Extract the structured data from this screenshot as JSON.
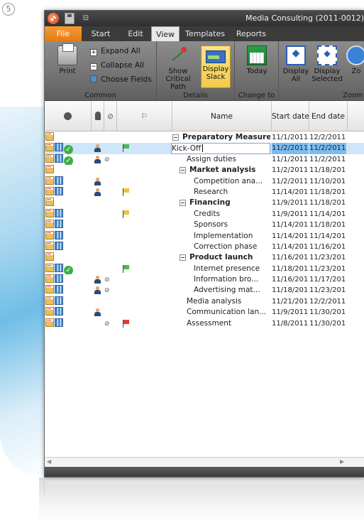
{
  "step_number": "5",
  "window": {
    "title": "Media Consulting (2011-0012)"
  },
  "ribbon_tabs": [
    "File",
    "Start",
    "Edit",
    "View",
    "Templates",
    "Reports"
  ],
  "active_tab": "View",
  "ribbon": {
    "common": {
      "label": "Common",
      "print": "Print",
      "expand_all": "Expand All",
      "collapse_all": "Collapse All",
      "choose_fields": "Choose Fields"
    },
    "details": {
      "label": "Details",
      "show_critical_path": "Show Critical Path",
      "display_slack": "Display Slack"
    },
    "change_to": {
      "label": "Change to",
      "today": "Today"
    },
    "zoom": {
      "label": "Zoom",
      "display_all": "Display All",
      "display_selected": "Display Selected",
      "zoom_partial": "Zo"
    }
  },
  "grid": {
    "columns": {
      "name": "Name",
      "start_date": "Start date",
      "end_date": "End date"
    },
    "rows": [
      {
        "icons": [
          "note"
        ],
        "user": false,
        "attach": false,
        "flag": "",
        "indent": 0,
        "toggle": "−",
        "name": "Preparatory Measures",
        "bold": true,
        "start": "11/1/2011...",
        "end": "12/2/2011..."
      },
      {
        "icons": [
          "note",
          "grid2",
          "check"
        ],
        "user": true,
        "attach": false,
        "flag": "green",
        "indent": 0,
        "toggle": "",
        "name": "Kick-Off",
        "bold": false,
        "start": "11/2/2011...",
        "end": "11/2/2011...",
        "selected": true,
        "editing": true
      },
      {
        "icons": [
          "note",
          "grid2",
          "check"
        ],
        "user": true,
        "attach": true,
        "flag": "",
        "indent": 2,
        "toggle": "",
        "name": "Assign duties",
        "bold": false,
        "start": "11/1/2011...",
        "end": "11/2/2011..."
      },
      {
        "icons": [
          "note"
        ],
        "user": false,
        "attach": false,
        "flag": "",
        "indent": 1,
        "toggle": "−",
        "name": "Market analysis",
        "bold": true,
        "start": "11/2/2011...",
        "end": "11/18/201..."
      },
      {
        "icons": [
          "note",
          "grid2"
        ],
        "user": true,
        "attach": false,
        "flag": "",
        "indent": 3,
        "toggle": "",
        "name": "Competition ana...",
        "bold": false,
        "start": "11/2/2011...",
        "end": "11/10/201..."
      },
      {
        "icons": [
          "note",
          "grid2"
        ],
        "user": true,
        "attach": false,
        "flag": "yellow",
        "indent": 3,
        "toggle": "",
        "name": "Research",
        "bold": false,
        "start": "11/14/201...",
        "end": "11/18/201..."
      },
      {
        "icons": [
          "note"
        ],
        "user": false,
        "attach": false,
        "flag": "",
        "indent": 1,
        "toggle": "−",
        "name": "Financing",
        "bold": true,
        "start": "11/9/2011...",
        "end": "11/18/201..."
      },
      {
        "icons": [
          "note",
          "grid2"
        ],
        "user": false,
        "attach": false,
        "flag": "yellow",
        "indent": 3,
        "toggle": "",
        "name": "Credits",
        "bold": false,
        "start": "11/9/2011...",
        "end": "11/14/201..."
      },
      {
        "icons": [
          "note",
          "grid2"
        ],
        "user": false,
        "attach": false,
        "flag": "",
        "indent": 3,
        "toggle": "",
        "name": "Sponsors",
        "bold": false,
        "start": "11/14/201...",
        "end": "11/18/201..."
      },
      {
        "icons": [
          "note",
          "grid2"
        ],
        "user": false,
        "attach": false,
        "flag": "",
        "indent": 3,
        "toggle": "",
        "name": "Implementation",
        "bold": false,
        "start": "11/14/201...",
        "end": "11/14/201..."
      },
      {
        "icons": [
          "note",
          "grid2"
        ],
        "user": false,
        "attach": false,
        "flag": "",
        "indent": 3,
        "toggle": "",
        "name": "Correction phase",
        "bold": false,
        "start": "11/14/201...",
        "end": "11/16/201..."
      },
      {
        "icons": [
          "note"
        ],
        "user": false,
        "attach": false,
        "flag": "",
        "indent": 1,
        "toggle": "−",
        "name": "Product launch",
        "bold": true,
        "start": "11/16/201...",
        "end": "11/23/201..."
      },
      {
        "icons": [
          "note",
          "grid2",
          "check"
        ],
        "user": false,
        "attach": false,
        "flag": "green",
        "indent": 3,
        "toggle": "",
        "name": "Internet presence",
        "bold": false,
        "start": "11/18/201...",
        "end": "11/23/201..."
      },
      {
        "icons": [
          "note",
          "grid2"
        ],
        "user": true,
        "attach": true,
        "flag": "",
        "indent": 3,
        "toggle": "",
        "name": "Information bro...",
        "bold": false,
        "start": "11/16/201...",
        "end": "11/17/201..."
      },
      {
        "icons": [
          "note",
          "grid2"
        ],
        "user": true,
        "attach": true,
        "flag": "",
        "indent": 3,
        "toggle": "",
        "name": "Advertising mat...",
        "bold": false,
        "start": "11/18/201...",
        "end": "11/23/201..."
      },
      {
        "icons": [
          "note",
          "grid2"
        ],
        "user": false,
        "attach": false,
        "flag": "",
        "indent": 2,
        "toggle": "",
        "name": "Media analysis",
        "bold": false,
        "start": "11/21/201...",
        "end": "12/2/2011..."
      },
      {
        "icons": [
          "note",
          "grid2"
        ],
        "user": true,
        "attach": false,
        "flag": "",
        "indent": 2,
        "toggle": "",
        "name": "Communication lan...",
        "bold": false,
        "start": "11/9/2011...",
        "end": "11/30/201..."
      },
      {
        "icons": [
          "note",
          "grid2"
        ],
        "user": false,
        "attach": true,
        "flag": "red",
        "indent": 2,
        "toggle": "",
        "name": "Assessment",
        "bold": false,
        "start": "11/8/2011...",
        "end": "11/30/201..."
      }
    ]
  }
}
